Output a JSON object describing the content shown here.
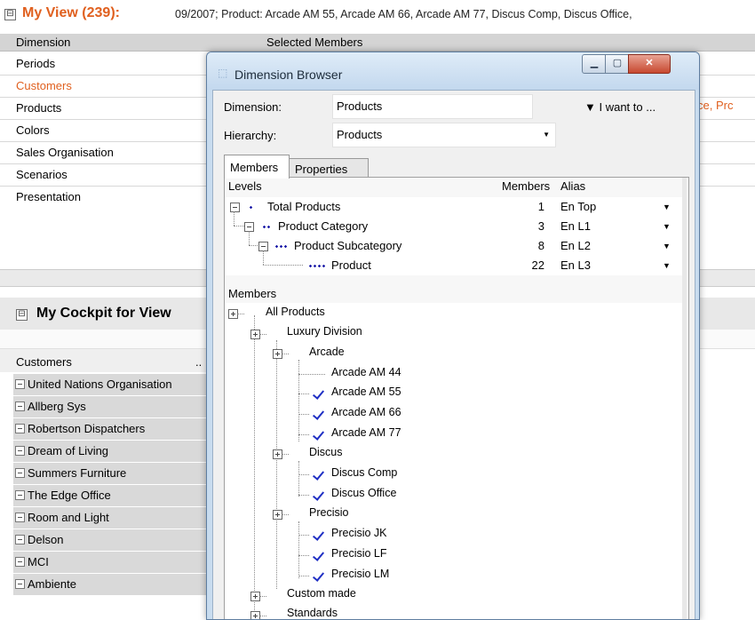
{
  "view": {
    "title": "My View (239):",
    "summary": "09/2007; Product: Arcade AM 55, Arcade AM 66, Arcade AM 77, Discus Comp, Discus Office,",
    "collapse_glyph": "⊟"
  },
  "dimension_table": {
    "col_dimension": "Dimension",
    "col_selected": "Selected Members",
    "rows": [
      "Periods",
      "Customers",
      "Products",
      "Colors",
      "Sales Organisation",
      "Scenarios",
      "Presentation"
    ],
    "active_row": "Customers",
    "products_fragment": "ce, Prc"
  },
  "cockpit": {
    "title": "My Cockpit for View",
    "customers_header": "Customers",
    "customers_dots": "..",
    "customers": [
      "United Nations Organisation",
      "Allberg Sys",
      "Robertson Dispatchers",
      "Dream of Living",
      "Summers Furniture",
      "The Edge Office",
      "Room and Light",
      "Delson",
      "MCI",
      "Ambiente"
    ]
  },
  "dialog": {
    "title": "Dimension Browser",
    "dimension_label": "Dimension:",
    "dimension_value": "Products",
    "i_want_to": "▼ I want to ...",
    "hierarchy_label": "Hierarchy:",
    "hierarchy_value": "Products",
    "tabs": [
      "Members",
      "Properties"
    ],
    "levels_header": {
      "levels": "Levels",
      "members": "Members",
      "alias": "Alias"
    },
    "levels": [
      {
        "name": "Total Products",
        "members": "1",
        "alias": "En Top"
      },
      {
        "name": "Product Category",
        "members": "3",
        "alias": "En L1"
      },
      {
        "name": "Product Subcategory",
        "members": "8",
        "alias": "En L2"
      },
      {
        "name": "Product",
        "members": "22",
        "alias": "En L3"
      }
    ],
    "members_header": "Members",
    "tree": {
      "root": "All Products",
      "luxury": "Luxury Division",
      "arcade": "Arcade",
      "arcade_items": [
        "Arcade AM 44",
        "Arcade AM 55",
        "Arcade AM 66",
        "Arcade AM 77"
      ],
      "discus": "Discus",
      "discus_items": [
        "Discus Comp",
        "Discus Office"
      ],
      "precisio": "Precisio",
      "precisio_items": [
        "Precisio JK",
        "Precisio LF",
        "Precisio LM"
      ],
      "custom": "Custom made",
      "standards": "Standards"
    },
    "colors": {
      "accent": "#e0601f",
      "check": "#1f2fc4",
      "level_dots": "#1c1ca8"
    }
  }
}
